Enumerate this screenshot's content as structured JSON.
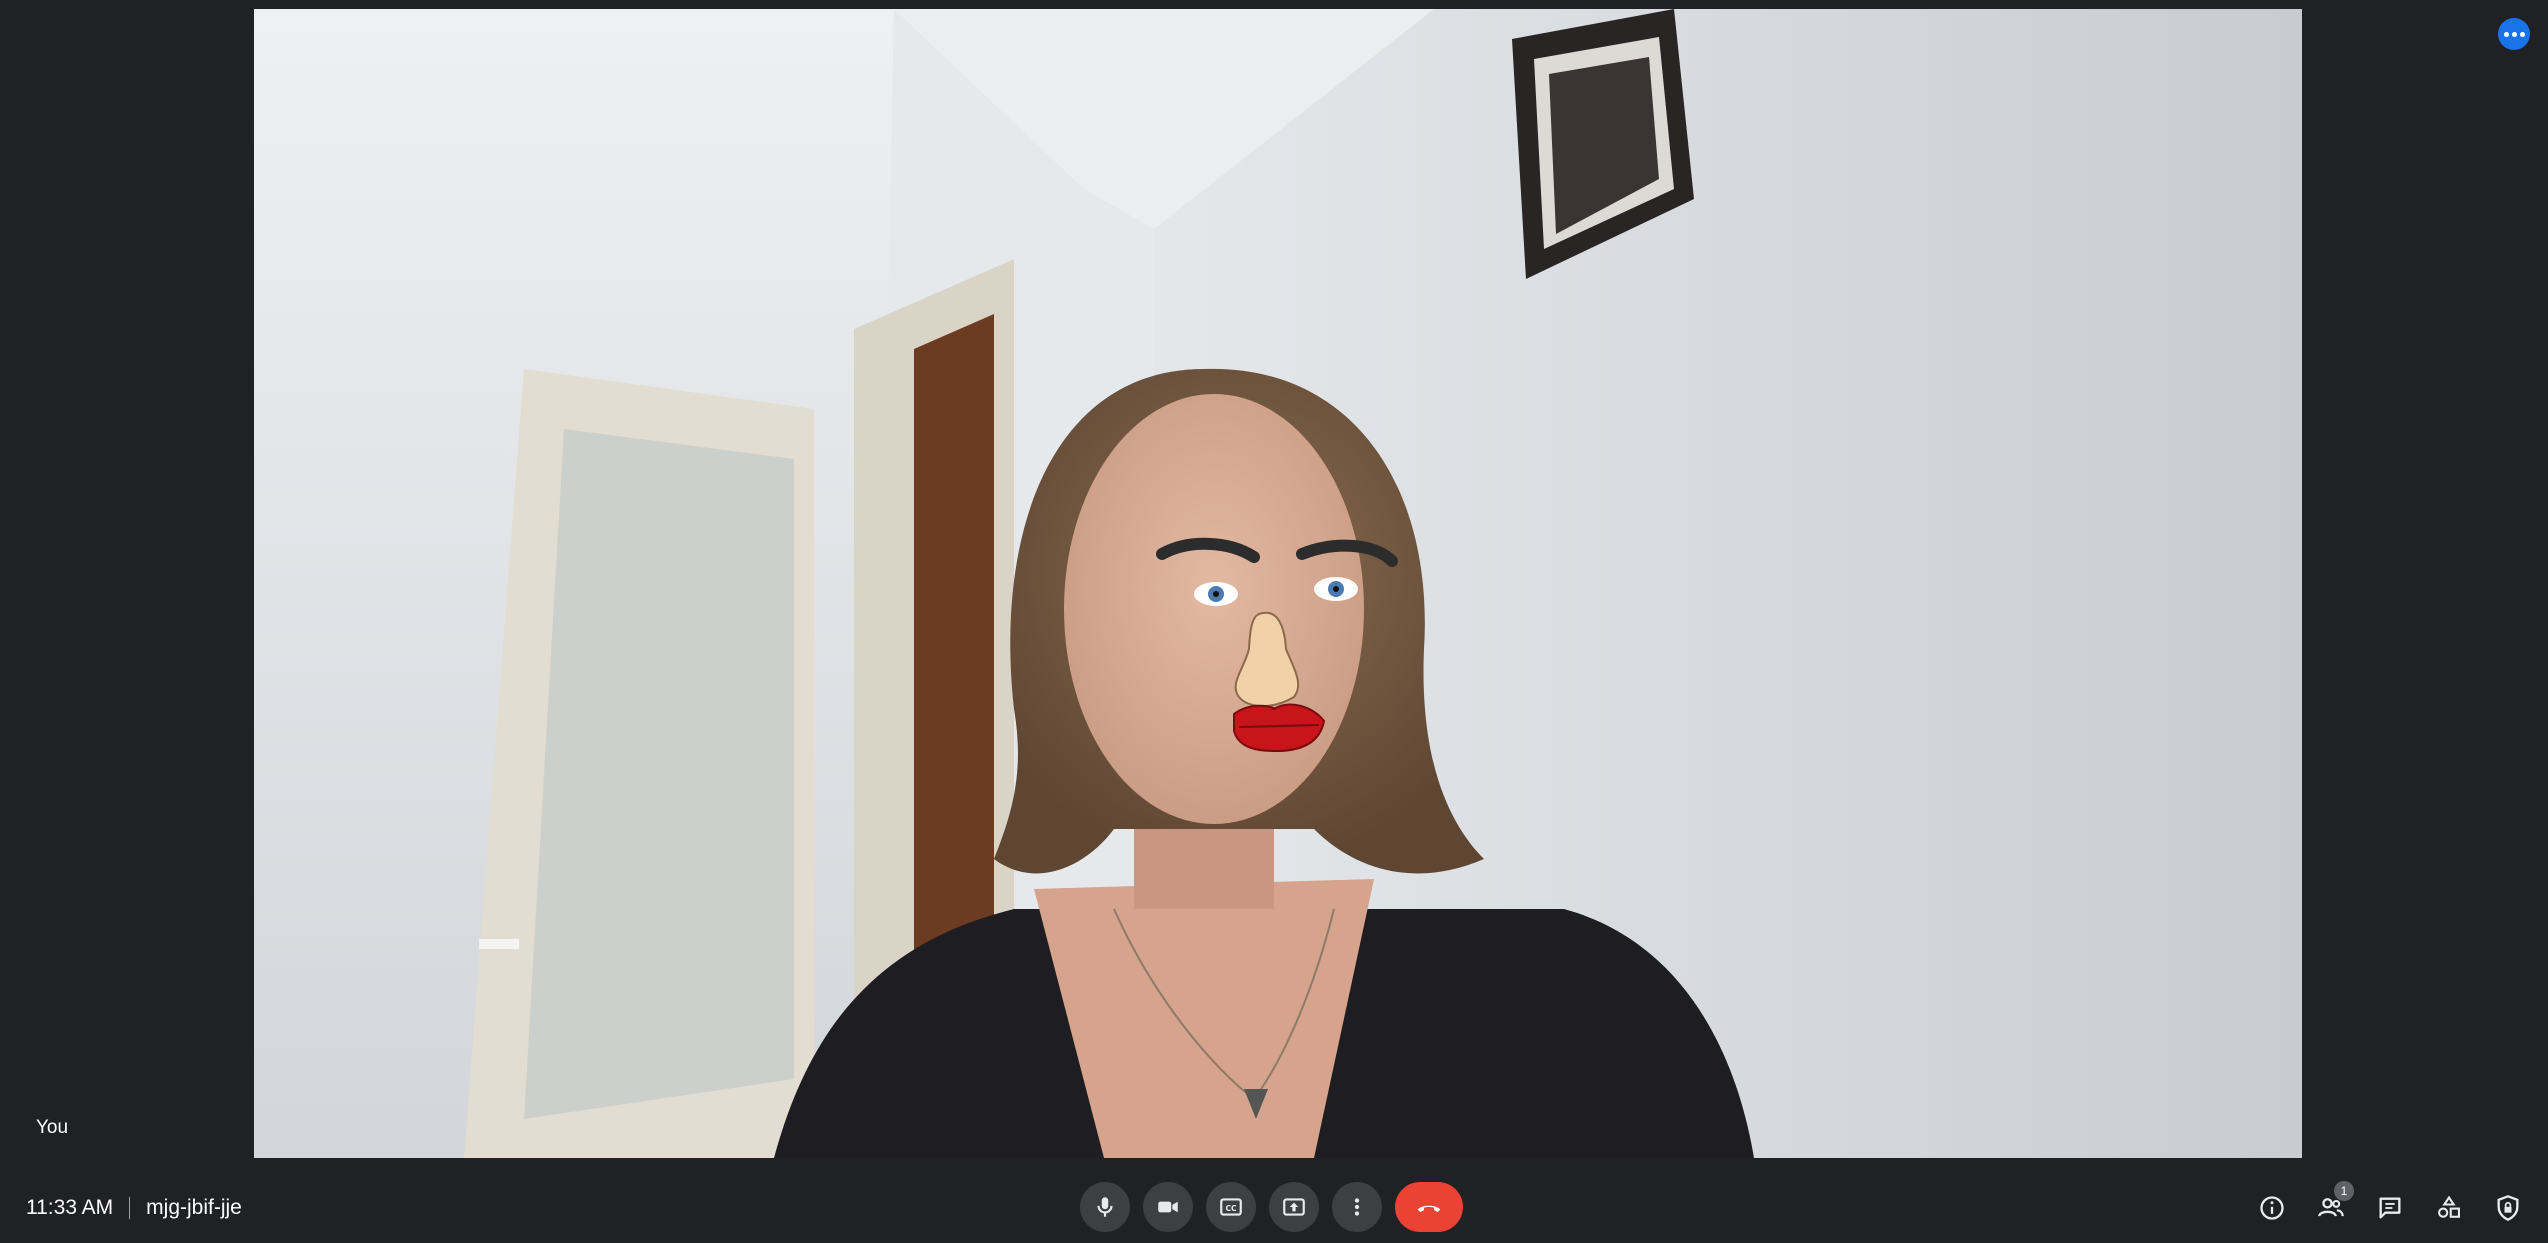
{
  "participant": {
    "self_label": "You"
  },
  "meeting": {
    "time": "11:33 AM",
    "code": "mjg-jbif-jje"
  },
  "controls": {
    "mic": "microphone-icon",
    "camera": "camera-icon",
    "captions": "captions-icon",
    "present": "present-screen-icon",
    "more": "more-options-icon",
    "leave": "hang-up-icon"
  },
  "side_panel": {
    "people_count": "1"
  },
  "colors": {
    "background": "#202124",
    "control_bg": "#3c4043",
    "hangup": "#ea4335",
    "accent": "#1a73e8"
  }
}
